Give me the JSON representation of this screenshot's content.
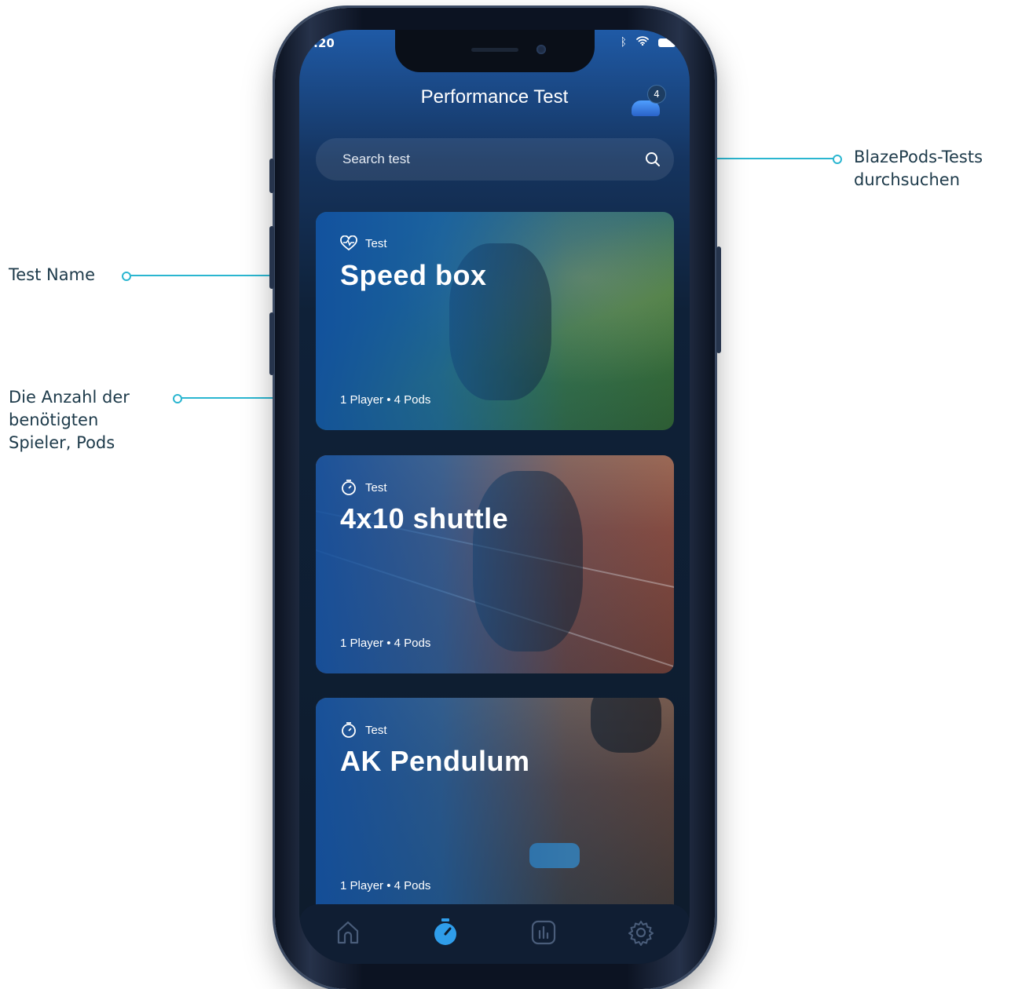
{
  "status_bar": {
    "time": ":20"
  },
  "header": {
    "title": "Performance Test",
    "pods_badge": "4"
  },
  "search": {
    "placeholder": "Search test"
  },
  "cards": [
    {
      "tag": "Test",
      "tag_icon": "heart-icon",
      "title": "Speed box",
      "meta": "1 Player • 4 Pods"
    },
    {
      "tag": "Test",
      "tag_icon": "stopwatch-icon",
      "title": "4x10 shuttle",
      "meta": "1 Player • 4 Pods"
    },
    {
      "tag": "Test",
      "tag_icon": "stopwatch-icon",
      "title": "AK Pendulum",
      "meta": "1 Player • 4 Pods"
    }
  ],
  "tabbar": {
    "items": [
      "home-icon",
      "stopwatch-icon",
      "stats-icon",
      "gear-icon"
    ],
    "active": "stopwatch-icon"
  },
  "annotations": {
    "search": "BlazePods-Tests\ndurchsuchen",
    "test_name": "Test Name",
    "count": "Die Anzahl der\nbenötigten\nSpieler, Pods"
  },
  "colors": {
    "accent": "#2bb6d0",
    "active_tab": "#2f9dea"
  }
}
